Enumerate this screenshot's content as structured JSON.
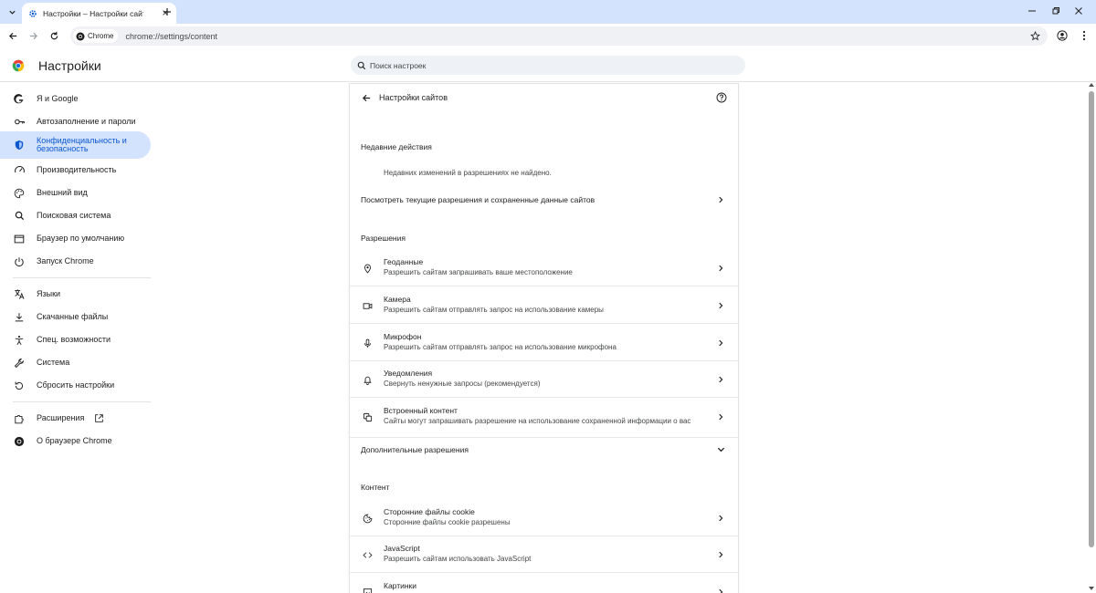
{
  "browser": {
    "tab_title": "Настройки – Настройки сайтов",
    "omnibox_chip": "Chrome",
    "url": "chrome://settings/content"
  },
  "header": {
    "title": "Настройки",
    "search_placeholder": "Поиск настроек"
  },
  "sidebar": {
    "items": [
      {
        "label": "Я и Google",
        "icon": "google-g-icon"
      },
      {
        "label": "Автозаполнение и пароли",
        "icon": "key-icon"
      },
      {
        "label": "Конфиденциальность и безопасность",
        "icon": "shield-icon",
        "active": true
      },
      {
        "label": "Производительность",
        "icon": "speedometer-icon"
      },
      {
        "label": "Внешний вид",
        "icon": "palette-icon"
      },
      {
        "label": "Поисковая система",
        "icon": "search-icon"
      },
      {
        "label": "Браузер по умолчанию",
        "icon": "browser-window-icon"
      },
      {
        "label": "Запуск Chrome",
        "icon": "power-icon"
      },
      {
        "label": "Языки",
        "icon": "translate-icon"
      },
      {
        "label": "Скачанные файлы",
        "icon": "download-icon"
      },
      {
        "label": "Спец. возможности",
        "icon": "accessibility-icon"
      },
      {
        "label": "Система",
        "icon": "wrench-icon"
      },
      {
        "label": "Сбросить настройки",
        "icon": "reset-icon"
      },
      {
        "label": "Расширения",
        "icon": "puzzle-icon"
      },
      {
        "label": "О браузере Chrome",
        "icon": "chrome-logo-icon"
      }
    ]
  },
  "main": {
    "title": "Настройки сайтов",
    "recent": {
      "title": "Недавние действия",
      "empty": "Недавних изменений в разрешениях не найдено.",
      "view_all": "Посмотреть текущие разрешения и сохраненные данные сайтов"
    },
    "permissions": {
      "title": "Разрешения",
      "items": [
        {
          "title": "Геоданные",
          "subtitle": "Разрешить сайтам запрашивать ваше местоположение",
          "icon": "location-pin-icon"
        },
        {
          "title": "Камера",
          "subtitle": "Разрешить сайтам отправлять запрос на использование камеры",
          "icon": "camera-icon"
        },
        {
          "title": "Микрофон",
          "subtitle": "Разрешить сайтам отправлять запрос на использование микрофона",
          "icon": "microphone-icon"
        },
        {
          "title": "Уведомления",
          "subtitle": "Свернуть ненужные запросы (рекомендуется)",
          "icon": "bell-icon"
        },
        {
          "title": "Встроенный контент",
          "subtitle": "Сайты могут запрашивать разрешение на использование сохраненной информации о вас",
          "icon": "embedded-content-icon"
        }
      ],
      "more": "Дополнительные разрешения"
    },
    "content": {
      "title": "Контент",
      "items": [
        {
          "title": "Сторонние файлы cookie",
          "subtitle": "Сторонние файлы cookie разрешены",
          "icon": "cookie-icon"
        },
        {
          "title": "JavaScript",
          "subtitle": "Разрешить сайтам использовать JavaScript",
          "icon": "code-icon"
        },
        {
          "title": "Картинки",
          "subtitle": "",
          "icon": "image-icon"
        }
      ]
    }
  },
  "colors": {
    "tabstrip": "#d3e3fd",
    "active_nav_bg": "#d3e3fd",
    "active_nav_text": "#0b57d0"
  }
}
